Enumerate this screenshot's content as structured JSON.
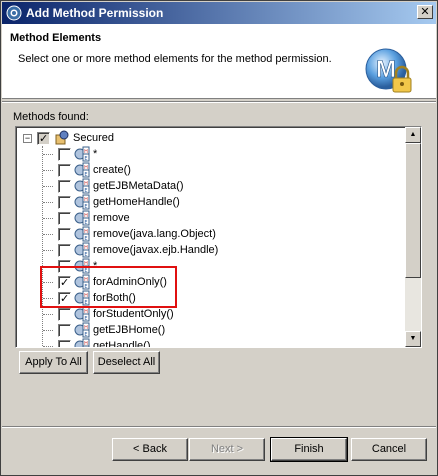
{
  "window": {
    "title": "Add Method Permission",
    "close_label": "✕"
  },
  "header": {
    "title": "Method Elements",
    "description": "Select one or more method elements for the method permission."
  },
  "tree": {
    "label": "Methods found:",
    "root": {
      "label": "Secured",
      "state": "partial"
    },
    "items": [
      {
        "label": "*",
        "checked": false
      },
      {
        "label": "create()",
        "checked": false
      },
      {
        "label": "getEJBMetaData()",
        "checked": false
      },
      {
        "label": "getHomeHandle()",
        "checked": false
      },
      {
        "label": "remove",
        "checked": false
      },
      {
        "label": "remove(java.lang.Object)",
        "checked": false
      },
      {
        "label": "remove(javax.ejb.Handle)",
        "checked": false
      },
      {
        "label": "*",
        "checked": false
      },
      {
        "label": "forAdminOnly()",
        "checked": true
      },
      {
        "label": "forBoth()",
        "checked": true
      },
      {
        "label": "forStudentOnly()",
        "checked": false
      },
      {
        "label": "getEJBHome()",
        "checked": false
      },
      {
        "label": "getHandle()",
        "checked": false
      }
    ]
  },
  "buttons": {
    "apply_to_all": "Apply To All",
    "deselect_all": "Deselect All",
    "back": "< Back",
    "next": "Next >",
    "finish": "Finish",
    "cancel": "Cancel"
  },
  "colors": {
    "title_start": "#0a246a",
    "title_end": "#a6caf0",
    "highlight": "#e01010"
  }
}
